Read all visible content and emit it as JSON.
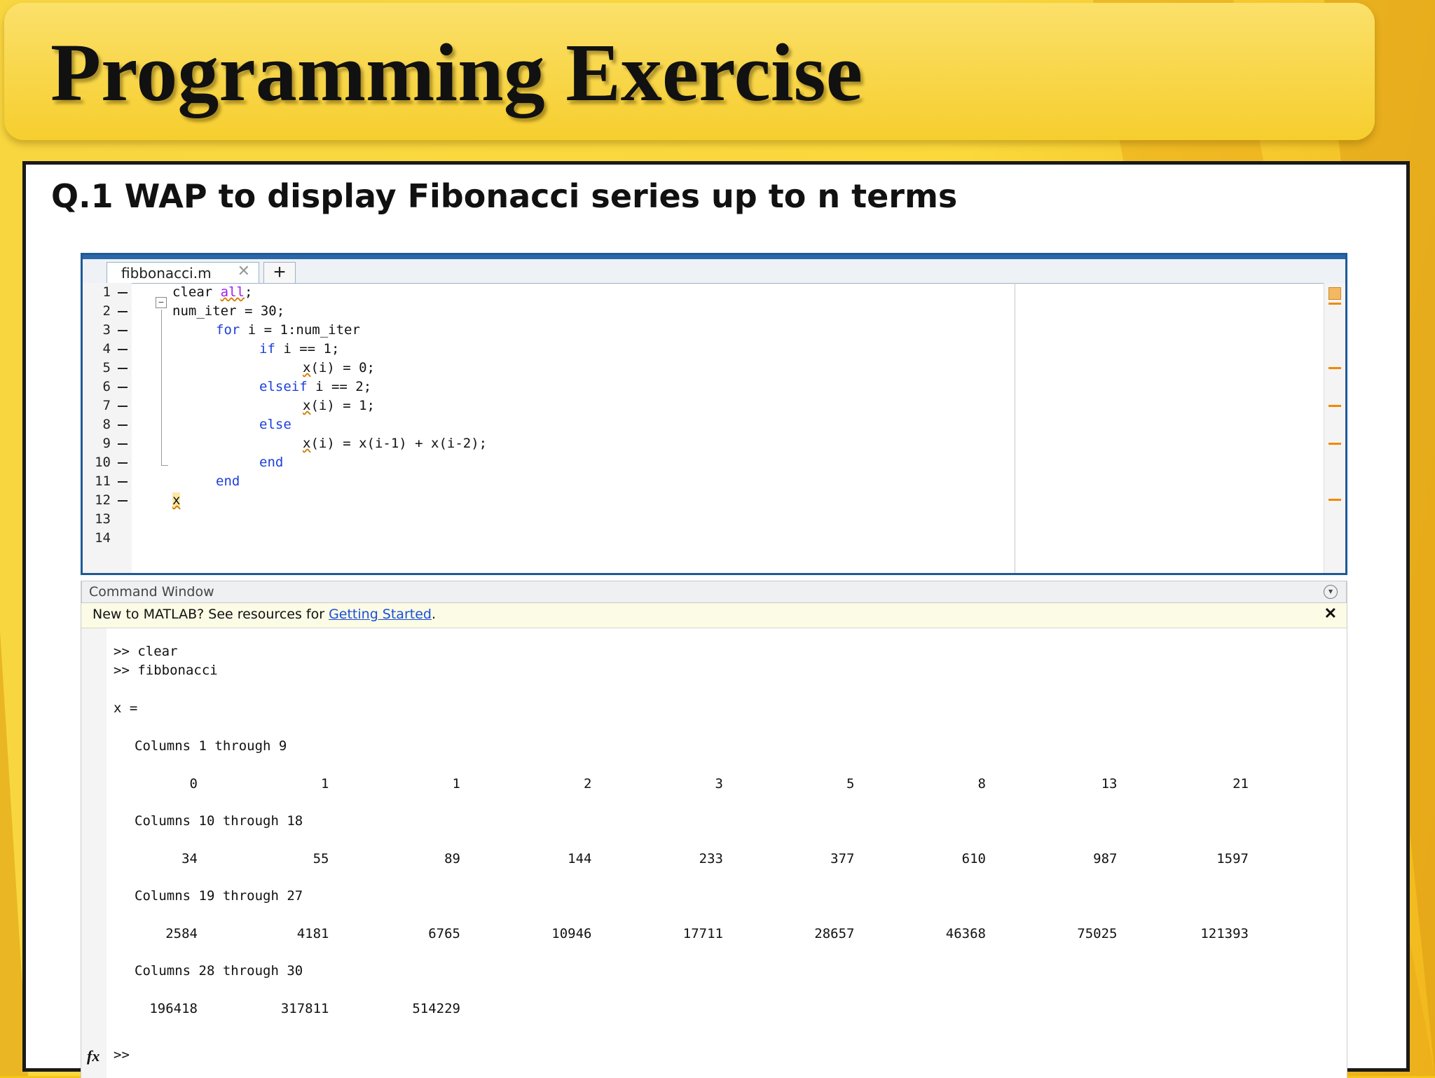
{
  "slide": {
    "title": "Programming Exercise",
    "question": "Q.1 WAP to display Fibonacci series up to n terms"
  },
  "editor": {
    "tab_name": "fibbonacci.m",
    "line_numbers": [
      "1",
      "2",
      "3",
      "4",
      "5",
      "6",
      "7",
      "8",
      "9",
      "10",
      "11",
      "12",
      "13",
      "14"
    ]
  },
  "command_window": {
    "title": "Command Window",
    "notice_prefix": "New to MATLAB? See resources for ",
    "notice_link": "Getting Started",
    "notice_suffix": ".",
    "prompt_lines": [
      ">> clear",
      ">> fibbonacci"
    ],
    "var_line": "x =",
    "column_headers": [
      "Columns 1 through 9",
      "Columns 10 through 18",
      "Columns 19 through 27",
      "Columns 28 through 30"
    ],
    "rows": [
      [
        "0",
        "1",
        "1",
        "2",
        "3",
        "5",
        "8",
        "13",
        "21"
      ],
      [
        "34",
        "55",
        "89",
        "144",
        "233",
        "377",
        "610",
        "987",
        "1597"
      ],
      [
        "2584",
        "4181",
        "6765",
        "10946",
        "17711",
        "28657",
        "46368",
        "75025",
        "121393"
      ],
      [
        "196418",
        "317811",
        "514229"
      ]
    ],
    "final_prompt": ">>",
    "fx_label": "fx"
  }
}
